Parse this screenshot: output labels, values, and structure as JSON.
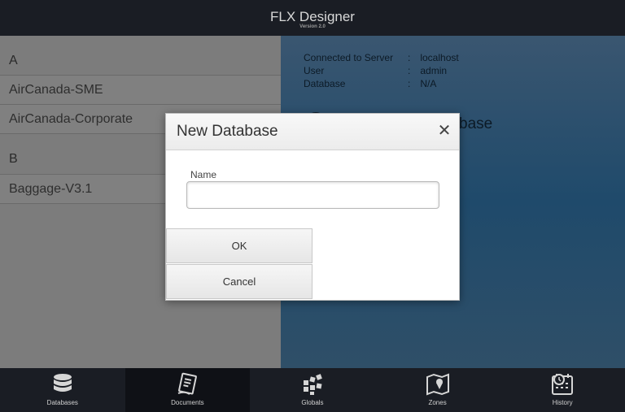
{
  "header": {
    "title": "FLX Designer",
    "version": "Version 2.0"
  },
  "databases": {
    "sections": [
      {
        "letter": "A",
        "items": [
          "AirCanada-SME",
          "AirCanada-Corporate"
        ]
      },
      {
        "letter": "B",
        "items": [
          "Baggage-V3.1"
        ]
      }
    ]
  },
  "connection": {
    "server_label": "Connected to Server",
    "server_value": "localhost",
    "user_label": "User",
    "user_value": "admin",
    "database_label": "Database",
    "database_value": "N/A",
    "separator": ":"
  },
  "behind_text": "base",
  "dialog": {
    "title": "New Database",
    "name_label": "Name",
    "name_value": "",
    "ok_label": "OK",
    "cancel_label": "Cancel"
  },
  "tabs": [
    {
      "label": "Databases",
      "icon": "database-icon",
      "active": false
    },
    {
      "label": "Documents",
      "icon": "document-icon",
      "active": true
    },
    {
      "label": "Globals",
      "icon": "globals-icon",
      "active": false
    },
    {
      "label": "Zones",
      "icon": "map-icon",
      "active": false
    },
    {
      "label": "History",
      "icon": "history-icon",
      "active": false
    }
  ]
}
